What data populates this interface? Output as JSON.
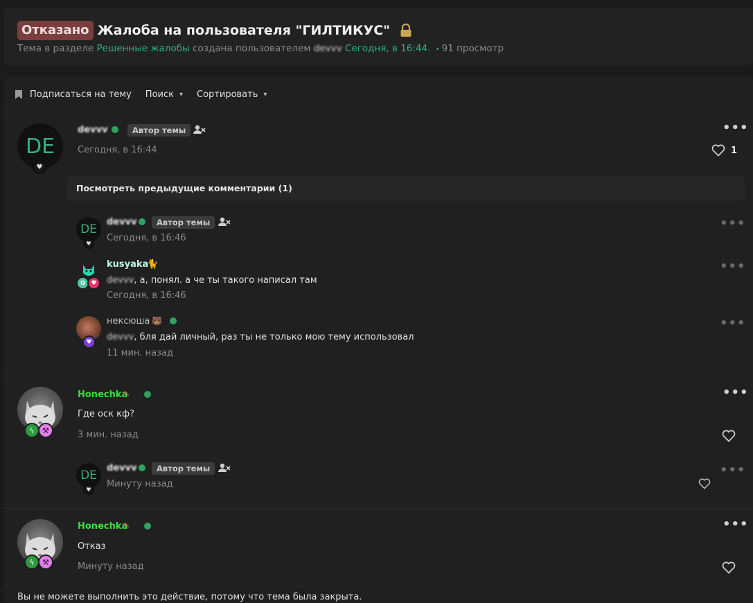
{
  "thread": {
    "status_tag": "Отказано",
    "title": "Жалоба на пользователя \"ГИЛТИКУС\"",
    "meta_prefix": "Тема в разделе",
    "section": "Решенные жалобы",
    "meta_created_by": "создана пользователем",
    "author": "devvv",
    "created_at": "Сегодня, в 16:44.",
    "views": "91 просмотр"
  },
  "toolbar": {
    "subscribe": "Подписаться на тему",
    "search": "Поиск",
    "sort": "Сортировать"
  },
  "main_post": {
    "avatar_initials": "DE",
    "username": "devvv",
    "author_tag": "Автор темы",
    "time": "Сегодня, в 16:44",
    "likes": "1"
  },
  "prev_comments": "Посмотреть предыдущие комментарии (1)",
  "comments": [
    {
      "avatar_initials": "DE",
      "username": "devvv",
      "author_tag": "Автор темы",
      "time": "Сегодня, в 16:46"
    },
    {
      "username": "kusyaka",
      "mention": "devvv",
      "text": ", а, понял. а че ты такого написал там",
      "time": "Сегодня, в 16:46"
    },
    {
      "username": "нексюша",
      "mention": "devvv",
      "text": ", бля дай личный, раз ты не только мою тему использовал",
      "time": "11 мин. назад"
    }
  ],
  "post2": {
    "username": "Honechka",
    "text": "Где оск кф?",
    "time": "3 мин. назад",
    "reply": {
      "avatar_initials": "DE",
      "username": "devvv",
      "author_tag": "Автор темы",
      "time": "Минуту назад"
    }
  },
  "post3": {
    "username": "Honechka",
    "text": "Отказ",
    "time": "Минуту назад"
  },
  "closed_note": "Вы не можете выполнить это действие, потому что тема была закрыта.",
  "colors": {
    "accent_green": "#2fb37a",
    "status_tag_bg": "#7a3e3e",
    "honechka_name": "#3ddc3d",
    "kusyaka_name": "#b8f5e0"
  },
  "icons": [
    "lock-icon",
    "bookmark-icon",
    "chevron-down-icon",
    "heart-icon",
    "more-icon",
    "person-x-icon",
    "online-dot"
  ]
}
